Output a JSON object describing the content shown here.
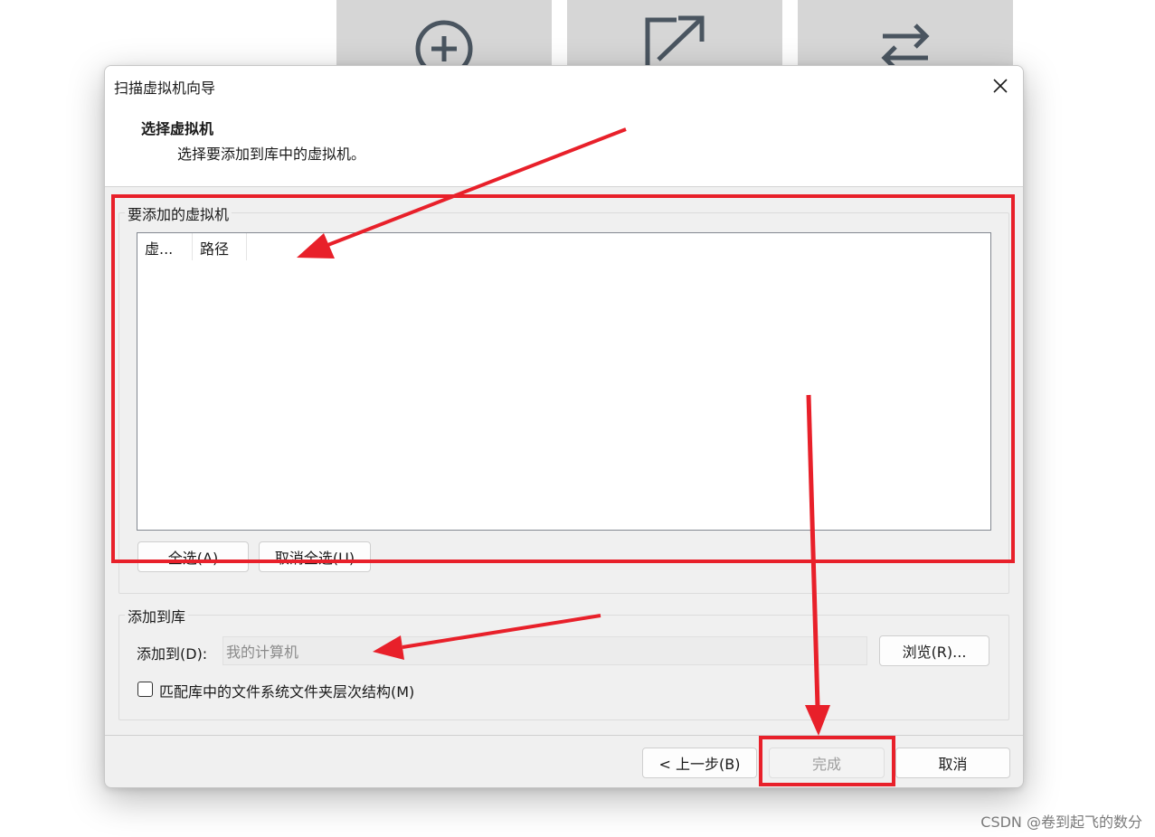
{
  "background_tiles": [
    {
      "icon": "plus-circle-icon"
    },
    {
      "icon": "open-external-icon"
    },
    {
      "icon": "swap-arrows-icon"
    }
  ],
  "dialog": {
    "title": "扫描虚拟机向导",
    "close_icon": "close-icon",
    "heading": "选择虚拟机",
    "subheading": "选择要添加到库中的虚拟机。",
    "vm_group": {
      "label": "要添加的虚拟机",
      "columns": [
        "虚...",
        "路径"
      ],
      "select_all": "全选(A)",
      "deselect_all": "取消全选(U)"
    },
    "library_group": {
      "label": "添加到库",
      "add_to_label": "添加到(D):",
      "add_to_value": "我的计算机",
      "browse": "浏览(R)...",
      "match_checkbox_label": "匹配库中的文件系统文件夹层次结构(M)",
      "match_checked": false
    },
    "footer": {
      "back": "< 上一步(B)",
      "finish": "完成",
      "cancel": "取消"
    }
  },
  "annotation_color": "#e8202a",
  "watermark": "CSDN @卷到起飞的数分"
}
